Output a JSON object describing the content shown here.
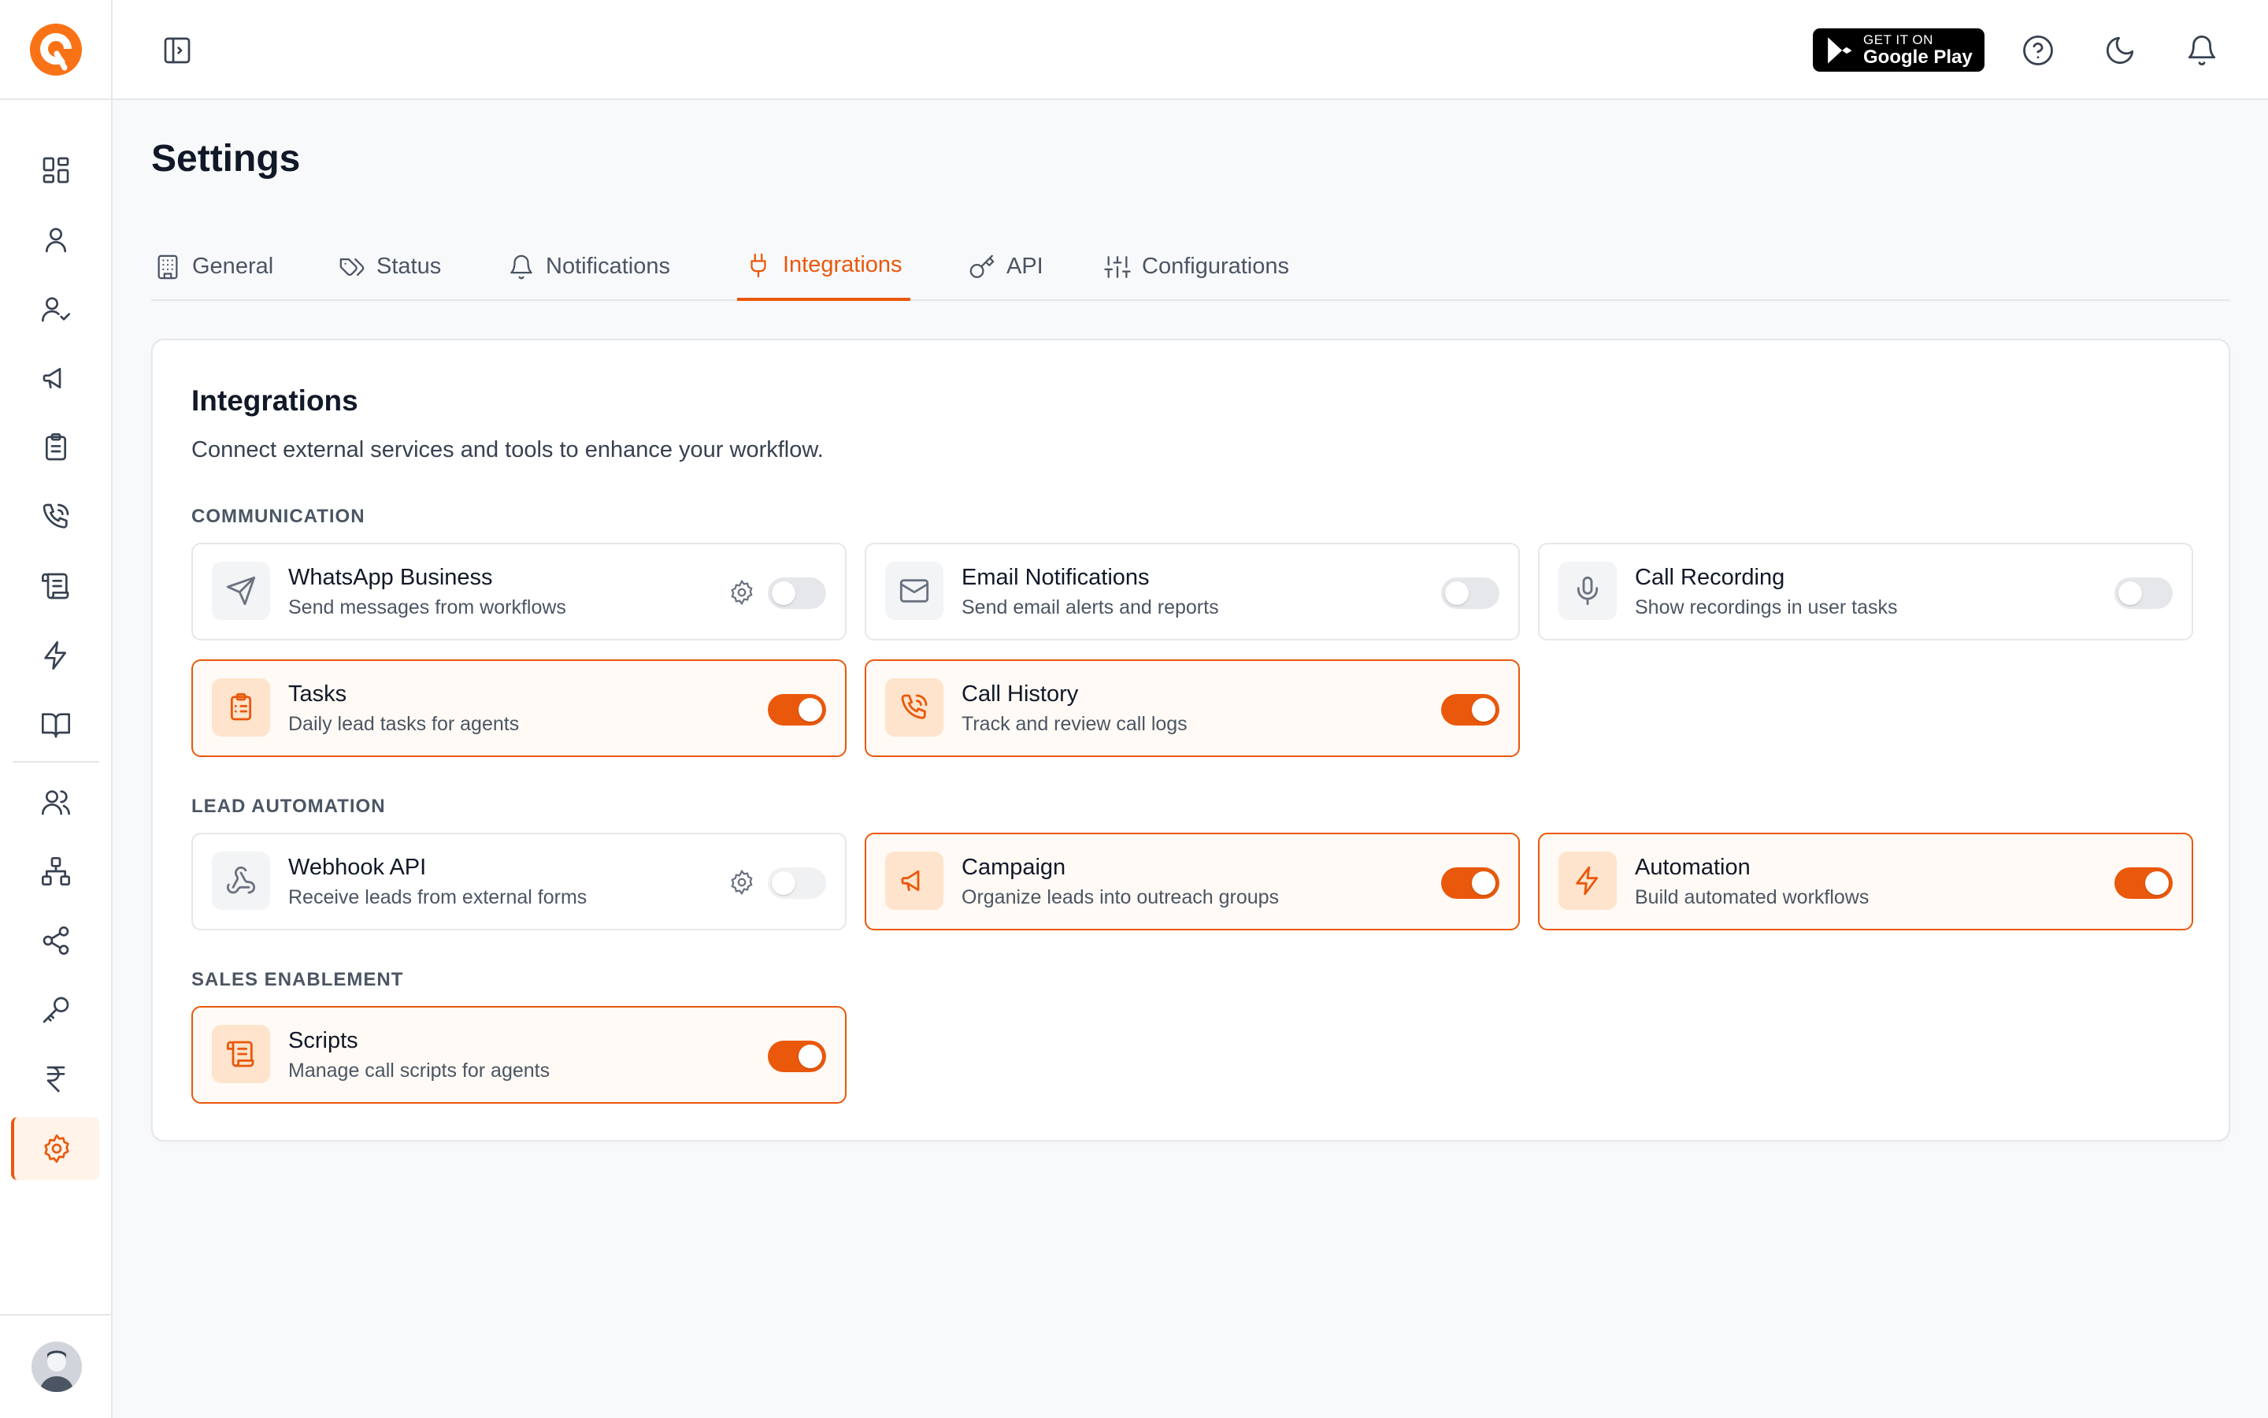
{
  "colors": {
    "accent": "#ea580c",
    "accent_bg": "#fee4cc",
    "border": "#e5e7eb"
  },
  "sidebar": {
    "items": [
      {
        "name": "dashboard-icon"
      },
      {
        "name": "user-icon"
      },
      {
        "name": "user-check-icon"
      },
      {
        "name": "megaphone-icon"
      },
      {
        "name": "clipboard-icon"
      },
      {
        "name": "phone-call-icon"
      },
      {
        "name": "scroll-icon"
      },
      {
        "name": "zap-icon"
      },
      {
        "name": "book-open-icon"
      },
      {
        "name": "users-icon"
      },
      {
        "name": "network-icon"
      },
      {
        "name": "share-icon"
      },
      {
        "name": "key-icon"
      },
      {
        "name": "rupee-icon"
      },
      {
        "name": "settings-icon",
        "active": true
      }
    ]
  },
  "header": {
    "gplay_small": "GET IT ON",
    "gplay_big": "Google Play"
  },
  "page": {
    "title": "Settings"
  },
  "tabs": [
    {
      "label": "General"
    },
    {
      "label": "Status"
    },
    {
      "label": "Notifications"
    },
    {
      "label": "Integrations",
      "active": true
    },
    {
      "label": "API"
    },
    {
      "label": "Configurations"
    }
  ],
  "card": {
    "title": "Integrations",
    "description": "Connect external services and tools to enhance your workflow."
  },
  "sections": {
    "communication": "COMMUNICATION",
    "lead_automation": "LEAD AUTOMATION",
    "sales_enablement": "SALES ENABLEMENT"
  },
  "integrations": {
    "whatsapp": {
      "name": "WhatsApp Business",
      "desc": "Send messages from workflows",
      "enabled": false,
      "icon": "send-icon"
    },
    "email": {
      "name": "Email Notifications",
      "desc": "Send email alerts and reports",
      "enabled": false,
      "icon": "mail-icon"
    },
    "call_recording": {
      "name": "Call Recording",
      "desc": "Show recordings in user tasks",
      "enabled": false,
      "icon": "mic-icon"
    },
    "tasks": {
      "name": "Tasks",
      "desc": "Daily lead tasks for agents",
      "enabled": true,
      "icon": "clipboard-icon"
    },
    "call_history": {
      "name": "Call History",
      "desc": "Track and review call logs",
      "enabled": true,
      "icon": "phone-call-icon"
    },
    "webhook": {
      "name": "Webhook API",
      "desc": "Receive leads from external forms",
      "enabled": false,
      "icon": "webhook-icon"
    },
    "campaign": {
      "name": "Campaign",
      "desc": "Organize leads into outreach groups",
      "enabled": true,
      "icon": "megaphone-icon"
    },
    "automation": {
      "name": "Automation",
      "desc": "Build automated workflows",
      "enabled": true,
      "icon": "zap-icon"
    },
    "scripts": {
      "name": "Scripts",
      "desc": "Manage call scripts for agents",
      "enabled": true,
      "icon": "scroll-icon"
    }
  }
}
